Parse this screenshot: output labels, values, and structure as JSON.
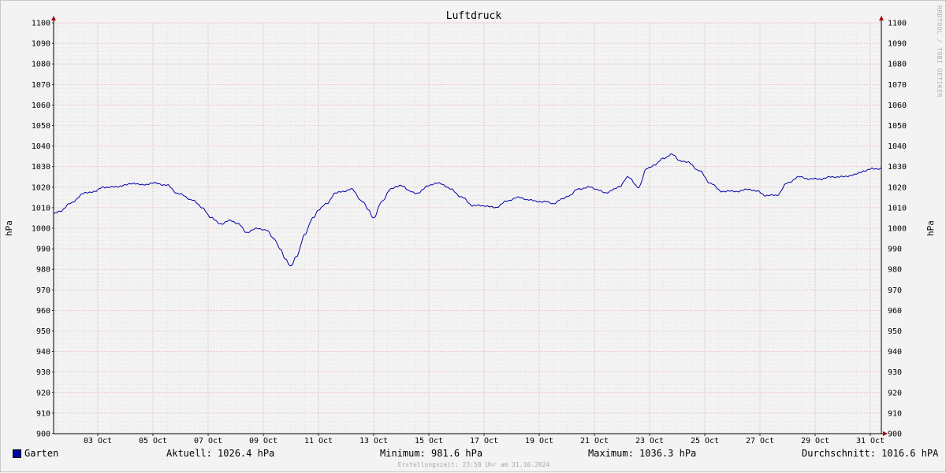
{
  "chart_data": {
    "type": "line",
    "title": "Luftdruck",
    "ylabel": "hPa",
    "ylim": [
      900,
      1100
    ],
    "y_ticks": [
      "900",
      "910",
      "920",
      "930",
      "940",
      "950",
      "960",
      "970",
      "980",
      "990",
      "1000",
      "1010",
      "1020",
      "1030",
      "1040",
      "1050",
      "1060",
      "1070",
      "1080",
      "1090",
      "1100"
    ],
    "x_ticks": [
      "03 Oct",
      "05 Oct",
      "07 Oct",
      "09 Oct",
      "11 Oct",
      "13 Oct",
      "15 Oct",
      "17 Oct",
      "19 Oct",
      "21 Oct",
      "23 Oct",
      "25 Oct",
      "27 Oct",
      "29 Oct",
      "31 Oct"
    ],
    "x_range_days": [
      1.4,
      31.4
    ],
    "grid": true,
    "series": [
      {
        "name": "Garten",
        "color": "#0000a8",
        "x_days": [
          1.4,
          1.6,
          2.0,
          2.5,
          2.9,
          3.2,
          3.6,
          4.0,
          4.3,
          4.6,
          5.0,
          5.5,
          5.9,
          6.4,
          6.8,
          7.1,
          7.5,
          7.8,
          8.1,
          8.4,
          8.8,
          9.1,
          9.4,
          9.6,
          9.8,
          10.0,
          10.2,
          10.5,
          10.8,
          11.0,
          11.3,
          11.6,
          11.9,
          12.2,
          12.6,
          12.8,
          13.0,
          13.3,
          13.6,
          14.0,
          14.3,
          14.6,
          15.0,
          15.4,
          15.8,
          16.2,
          16.6,
          17.0,
          17.4,
          17.8,
          18.2,
          18.6,
          18.9,
          19.2,
          19.5,
          19.8,
          20.1,
          20.4,
          20.8,
          21.1,
          21.4,
          21.7,
          21.9,
          22.2,
          22.6,
          22.9,
          23.2,
          23.5,
          23.8,
          24.1,
          24.4,
          24.8,
          25.2,
          25.6,
          25.9,
          26.2,
          26.6,
          26.9,
          27.2,
          27.6,
          28.0,
          28.4,
          28.8,
          29.2,
          29.6,
          30.0,
          30.4,
          30.8,
          31.1,
          31.4
        ],
        "values": [
          1007,
          1008,
          1012,
          1017,
          1018,
          1020,
          1020,
          1021,
          1022,
          1021,
          1022,
          1021,
          1017,
          1014,
          1010,
          1005,
          1002,
          1004,
          1002,
          998,
          1000,
          999,
          995,
          990,
          985,
          981.6,
          986,
          997,
          1005,
          1009,
          1012,
          1017,
          1018,
          1019,
          1013,
          1009,
          1005,
          1013,
          1019,
          1021,
          1018,
          1017,
          1021,
          1022,
          1019,
          1015,
          1011,
          1011,
          1010,
          1013,
          1015,
          1014,
          1013,
          1013,
          1012,
          1014,
          1016,
          1019,
          1020,
          1019,
          1017,
          1019,
          1020,
          1025,
          1020,
          1029,
          1031,
          1034,
          1036,
          1033,
          1032,
          1028,
          1022,
          1018,
          1018,
          1018,
          1019,
          1018,
          1016,
          1016,
          1022,
          1025,
          1024,
          1024,
          1025,
          1025,
          1026,
          1028,
          1029,
          1029
        ],
        "current": "Aktuell: 1026.4 hPa",
        "minimum": "Minimum: 981.6 hPa",
        "maximum": "Maximum: 1036.3 hPa",
        "average": "Durchschnitt: 1016.6 hPA"
      }
    ]
  },
  "footer": {
    "legend_label": "Garten",
    "current": "Aktuell: 1026.4 hPa",
    "minimum": "Minimum: 981.6 hPa",
    "maximum": "Maximum: 1036.3 hPa",
    "average": "Durchschnitt: 1016.6 hPA",
    "timestamp": "Erstellungszeit: 23:58 Uhr am 31.10.2024"
  },
  "watermark": "RRDTOOL / TOBI OETIKER"
}
